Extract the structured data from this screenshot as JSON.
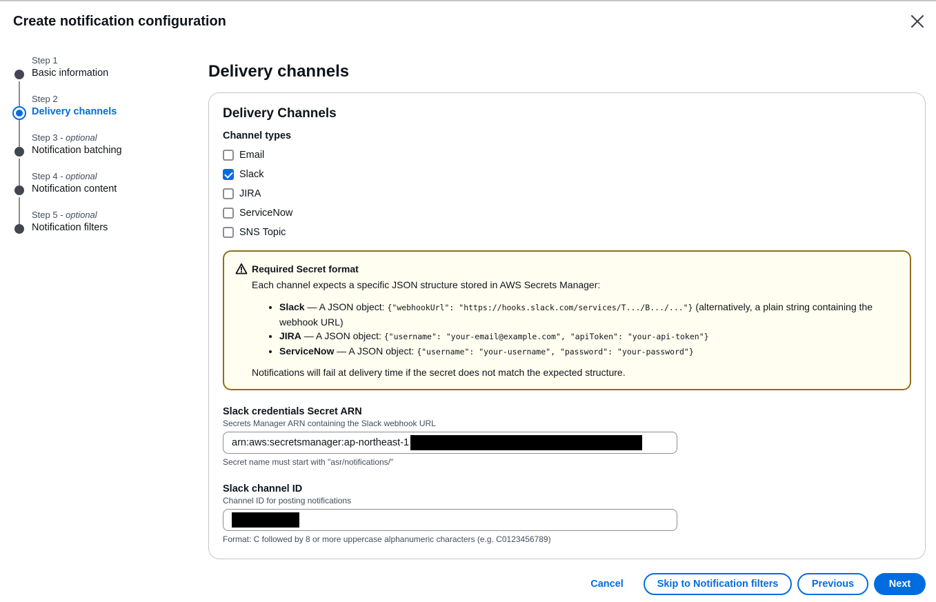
{
  "modal": {
    "title": "Create notification configuration"
  },
  "wizard": {
    "steps": [
      {
        "label": "Step 1",
        "optional": "",
        "title": "Basic information",
        "active": false
      },
      {
        "label": "Step 2",
        "optional": "",
        "title": "Delivery channels",
        "active": true
      },
      {
        "label": "Step 3 - ",
        "optional": "optional",
        "title": "Notification batching",
        "active": false
      },
      {
        "label": "Step 4 - ",
        "optional": "optional",
        "title": "Notification content",
        "active": false
      },
      {
        "label": "Step 5 - ",
        "optional": "optional",
        "title": "Notification filters",
        "active": false
      }
    ]
  },
  "page": {
    "heading": "Delivery channels"
  },
  "container": {
    "title": "Delivery Channels",
    "channel_types_label": "Channel types",
    "channels": [
      {
        "label": "Email",
        "checked": false
      },
      {
        "label": "Slack",
        "checked": true
      },
      {
        "label": "JIRA",
        "checked": false
      },
      {
        "label": "ServiceNow",
        "checked": false
      },
      {
        "label": "SNS Topic",
        "checked": false
      }
    ]
  },
  "alert": {
    "title": "Required Secret format",
    "text": "Each channel expects a specific JSON structure stored in AWS Secrets Manager:",
    "items": [
      {
        "name": "Slack",
        "prefix": " — A JSON object: ",
        "code": "{\"webhookUrl\": \"https://hooks.slack.com/services/T.../B.../...\"}",
        "suffix": " (alternatively, a plain string containing the webhook URL)"
      },
      {
        "name": "JIRA",
        "prefix": " — A JSON object: ",
        "code": "{\"username\": \"your-email@example.com\", \"apiToken\": \"your-api-token\"}",
        "suffix": ""
      },
      {
        "name": "ServiceNow",
        "prefix": " — A JSON object: ",
        "code": "{\"username\": \"your-username\", \"password\": \"your-password\"}",
        "suffix": ""
      }
    ],
    "footer": "Notifications will fail at delivery time if the secret does not match the expected structure."
  },
  "fields": {
    "arn": {
      "label": "Slack credentials Secret ARN",
      "description": "Secrets Manager ARN containing the Slack webhook URL",
      "value": "arn:aws:secretsmanager:ap-northeast-1",
      "hint": "Secret name must start with \"asr/notifications/\""
    },
    "channel_id": {
      "label": "Slack channel ID",
      "description": "Channel ID for posting notifications",
      "value": "",
      "hint": "Format: C followed by 8 or more uppercase alphanumeric characters (e.g. C0123456789)"
    }
  },
  "footer": {
    "cancel": "Cancel",
    "skip": "Skip to Notification filters",
    "previous": "Previous",
    "next": "Next"
  },
  "colors": {
    "accent": "#006ce0",
    "warning_border": "#8c6e1c",
    "warning_bg": "#fffef0"
  }
}
